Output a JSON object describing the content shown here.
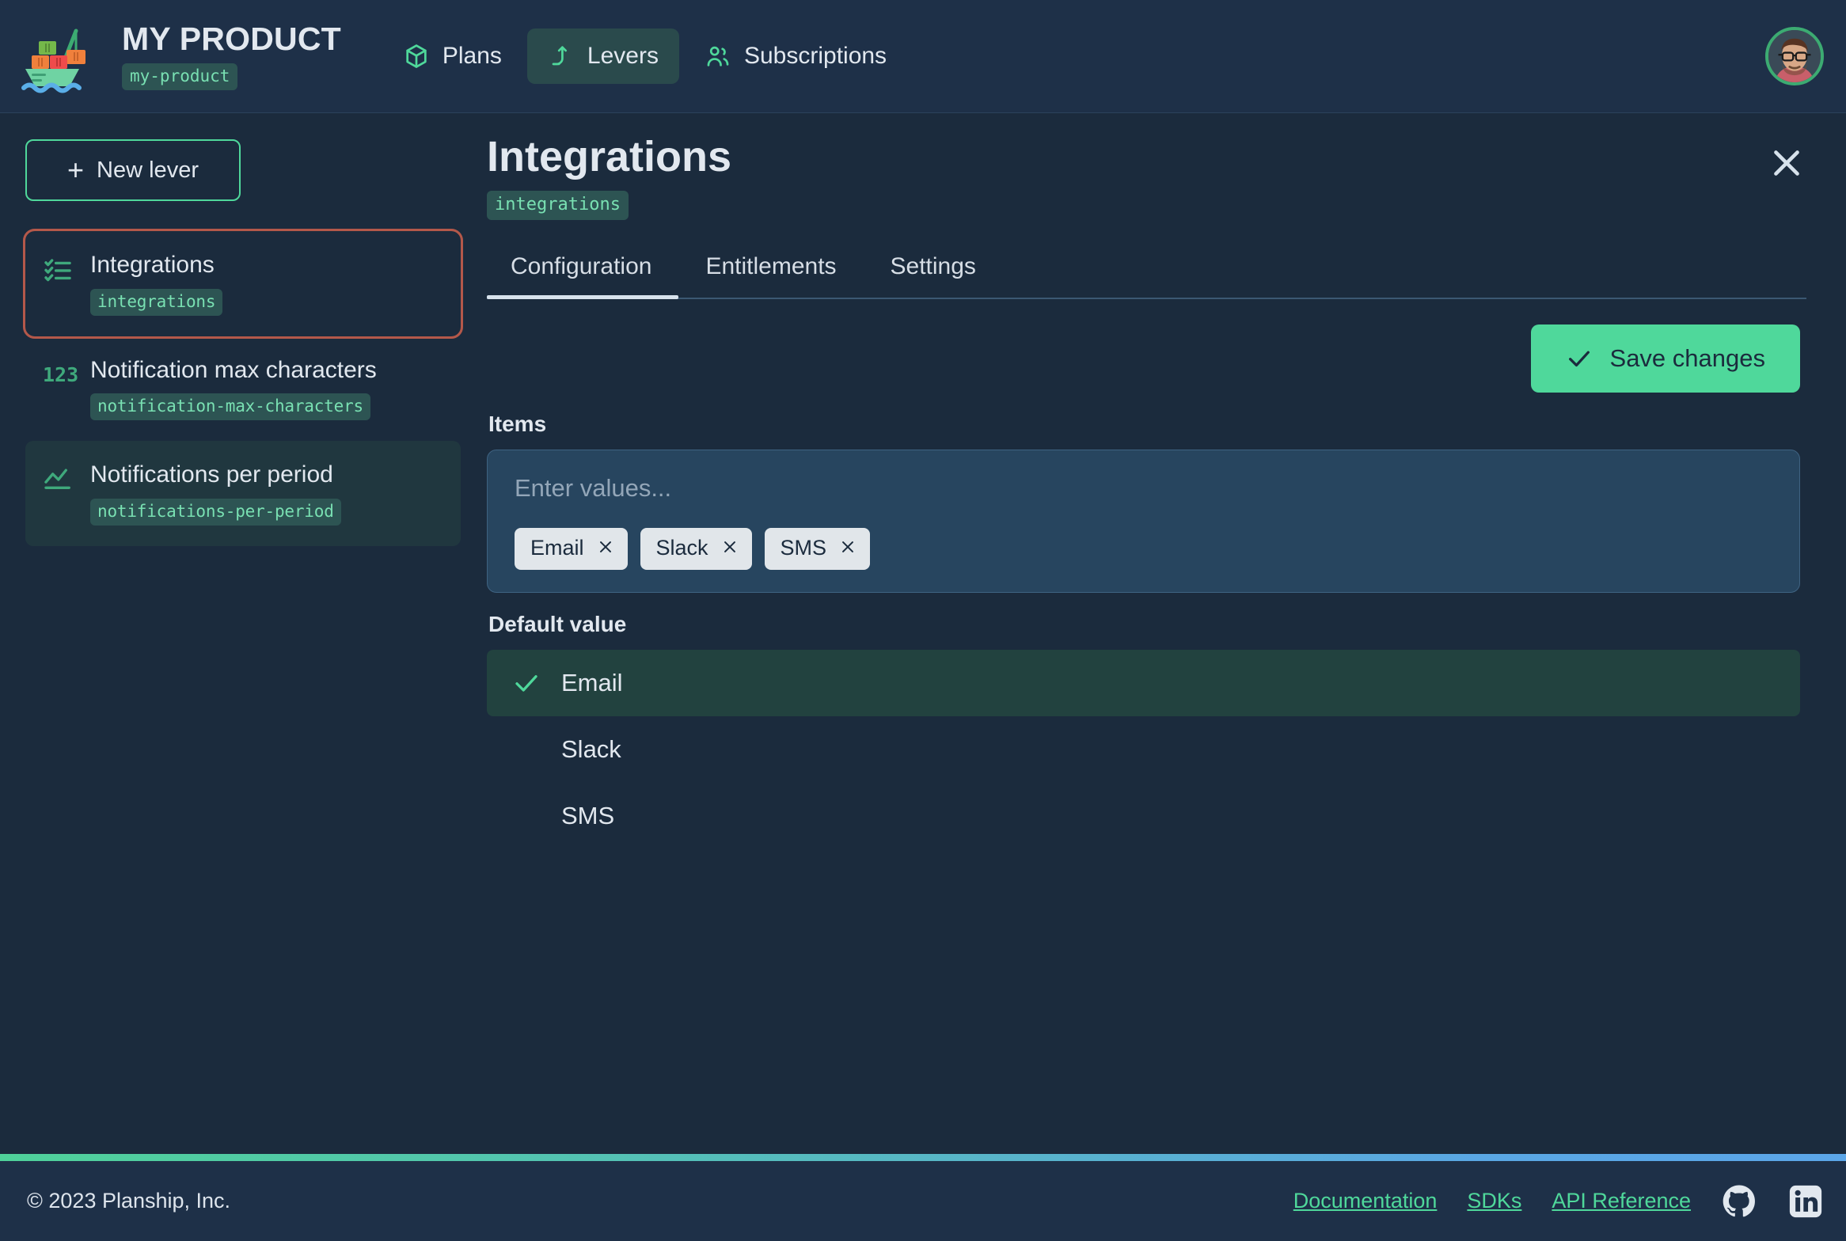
{
  "header": {
    "logo_icon": "container-ship-icon",
    "product_title": "MY PRODUCT",
    "product_slug": "my-product",
    "nav": [
      {
        "label": "Plans",
        "icon": "package-icon",
        "active": false
      },
      {
        "label": "Levers",
        "icon": "lever-icon",
        "active": true
      },
      {
        "label": "Subscriptions",
        "icon": "users-icon",
        "active": false
      }
    ],
    "avatar_icon": "user-avatar"
  },
  "sidebar": {
    "new_lever_label": "New lever",
    "new_lever_plus": "+",
    "items": [
      {
        "name": "Integrations",
        "slug": "integrations",
        "icon": "checklist-icon",
        "state": "selected"
      },
      {
        "name": "Notification max characters",
        "slug": "notification-max-characters",
        "icon": "123-icon",
        "state": "default"
      },
      {
        "name": "Notifications per period",
        "slug": "notifications-per-period",
        "icon": "line-chart-icon",
        "state": "hovered"
      }
    ]
  },
  "main": {
    "title": "Integrations",
    "slug": "integrations",
    "close_icon": "close-icon",
    "tabs": [
      {
        "label": "Configuration",
        "active": true
      },
      {
        "label": "Entitlements",
        "active": false
      },
      {
        "label": "Settings",
        "active": false
      }
    ],
    "save_label": "Save changes",
    "save_icon": "check-icon",
    "items_label": "Items",
    "items_placeholder": "Enter values...",
    "chips": [
      {
        "label": "Email",
        "remove_icon": "close-icon"
      },
      {
        "label": "Slack",
        "remove_icon": "close-icon"
      },
      {
        "label": "SMS",
        "remove_icon": "close-icon"
      }
    ],
    "default_value_label": "Default value",
    "options": [
      {
        "label": "Email",
        "selected": true
      },
      {
        "label": "Slack",
        "selected": false
      },
      {
        "label": "SMS",
        "selected": false
      }
    ]
  },
  "footer": {
    "copyright": "© 2023 Planship, Inc.",
    "links": [
      {
        "label": "Documentation"
      },
      {
        "label": "SDKs"
      },
      {
        "label": "API Reference"
      }
    ],
    "social": [
      {
        "icon": "github-icon"
      },
      {
        "icon": "linkedin-icon"
      }
    ]
  },
  "colors": {
    "background": "#1b2b3d",
    "panel": "#1e3048",
    "accent_green": "#4fd89b",
    "slug_bg": "#2d5453",
    "slug_text": "#79e0b2",
    "selected_outline": "#b4584a",
    "input_bg": "#27455f",
    "gradient_start": "#4fd19a",
    "gradient_end": "#5ba6e8"
  }
}
